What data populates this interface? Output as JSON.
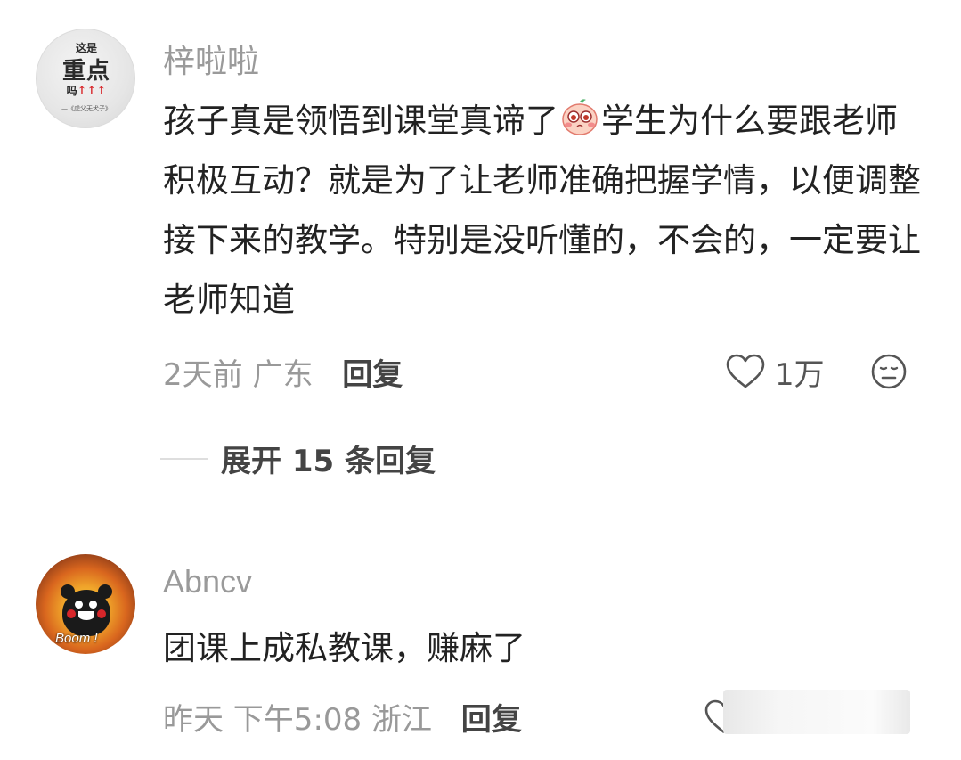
{
  "comments": [
    {
      "avatar": {
        "line1": "这是",
        "line2": "重点",
        "line3": "吗",
        "arrows": "↑↑↑",
        "line4": "—《虎父无犬子》"
      },
      "username": "梓啦啦",
      "text_before_emoji": "孩子真是领悟到课堂真谛了",
      "emoji": "pleading-face-sticker",
      "text_after_emoji": "学生为什么要跟老师积极互动？就是为了让老师准确把握学情，以便调整接下来的教学。特别是没听懂的，不会的，一定要让老师知道",
      "time": "2天前",
      "location": "广东",
      "reply_label": "回复",
      "like_count": "1万"
    },
    {
      "avatar": {
        "caption": "Boom !"
      },
      "username": "Abncv",
      "text": "团课上成私教课，赚麻了",
      "time": "昨天 下午5:08",
      "location": "浙江",
      "reply_label": "回复"
    }
  ],
  "expand_replies": {
    "label": "展开 15 条回复"
  },
  "icons": {
    "like": "heart-outline-icon",
    "dislike": "meh-face-icon"
  },
  "colors": {
    "username": "#9a9a9a",
    "meta": "#999999",
    "text": "#222222"
  }
}
